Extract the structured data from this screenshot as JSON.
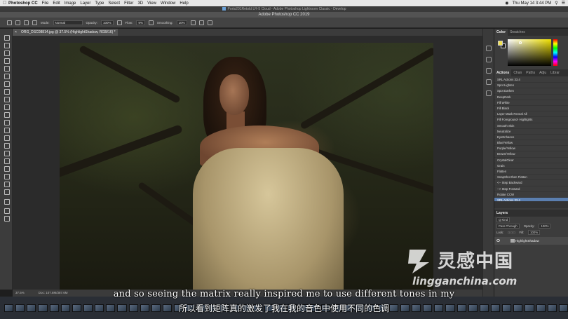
{
  "menubar": {
    "app_name": "Photoshop CC",
    "items": [
      "File",
      "Edit",
      "Image",
      "Layer",
      "Type",
      "Select",
      "Filter",
      "3D",
      "View",
      "Window",
      "Help"
    ],
    "clock": "Thu May 14  3:44 PM"
  },
  "lr_strip": {
    "title": "Ports201Retold LR-5 Cloud - Adobe Photoshop Lightroom Classic - Develop"
  },
  "ps_title": "Adobe Photoshop CC 2019",
  "options_bar": {
    "mode_label": "Mode:",
    "mode_value": "Normal",
    "opacity_label": "Opacity:",
    "opacity_value": "100%",
    "flow_label": "Flow:",
    "flow_value": "9%",
    "smoothing_label": "Smoothing:",
    "smoothing_value": "10%"
  },
  "document_tab": "ORG_DSC08814.jpg @ 37.5% (HighlightShadow, RGB/16) *",
  "status_bar": {
    "zoom": "37.5%",
    "doc": "Doc: 107.8M/387.6M"
  },
  "right_panels": {
    "color_tabs": [
      "Color",
      "Swatches"
    ],
    "colors": {
      "foreground": "#f0e050",
      "background": "#222222",
      "accent_selection": "#5b7fb0"
    },
    "actions_tabs": [
      "Actions",
      "Chan",
      "Paths",
      "Adju",
      "Librar"
    ],
    "actions": [
      "SRL Actions 33.4",
      "Spot Lighten",
      "Spot Darken",
      "DeepDark",
      "Fill White",
      "Fill Black",
      "Layer Mask Reveal All",
      "Fill Foreground- Highlights",
      "Smooth Skin",
      "Neutralize",
      "EyeEnhance",
      "Blue/Yellow",
      "Purple/Yellow",
      "Brown/Yellow",
      "CrystalClear",
      "Grain",
      "Flatten",
      "SnapShot then Flatten",
      "<-- Step Backward",
      "--> Step Forward",
      "Rotate CCW",
      "SRL Actions 33.4"
    ],
    "selected_action_index": 21,
    "layers": {
      "title": "Layers",
      "kind_filter": "Q Kind",
      "blend_mode": "Pass Through",
      "opacity_label": "Opacity:",
      "opacity_value": "100%",
      "lock_label": "Lock:",
      "fill_label": "Fill:",
      "fill_value": "100%",
      "layer_name": "HighlightShadow"
    }
  },
  "subtitles": {
    "english": "and so seeing the matrix really inspired me to use different tones in my",
    "chinese": "所以看到矩阵真的激发了我在我的音色中使用不同的色调"
  },
  "watermark": {
    "text_cn": "灵感中国",
    "url": "lingganchina.com"
  }
}
